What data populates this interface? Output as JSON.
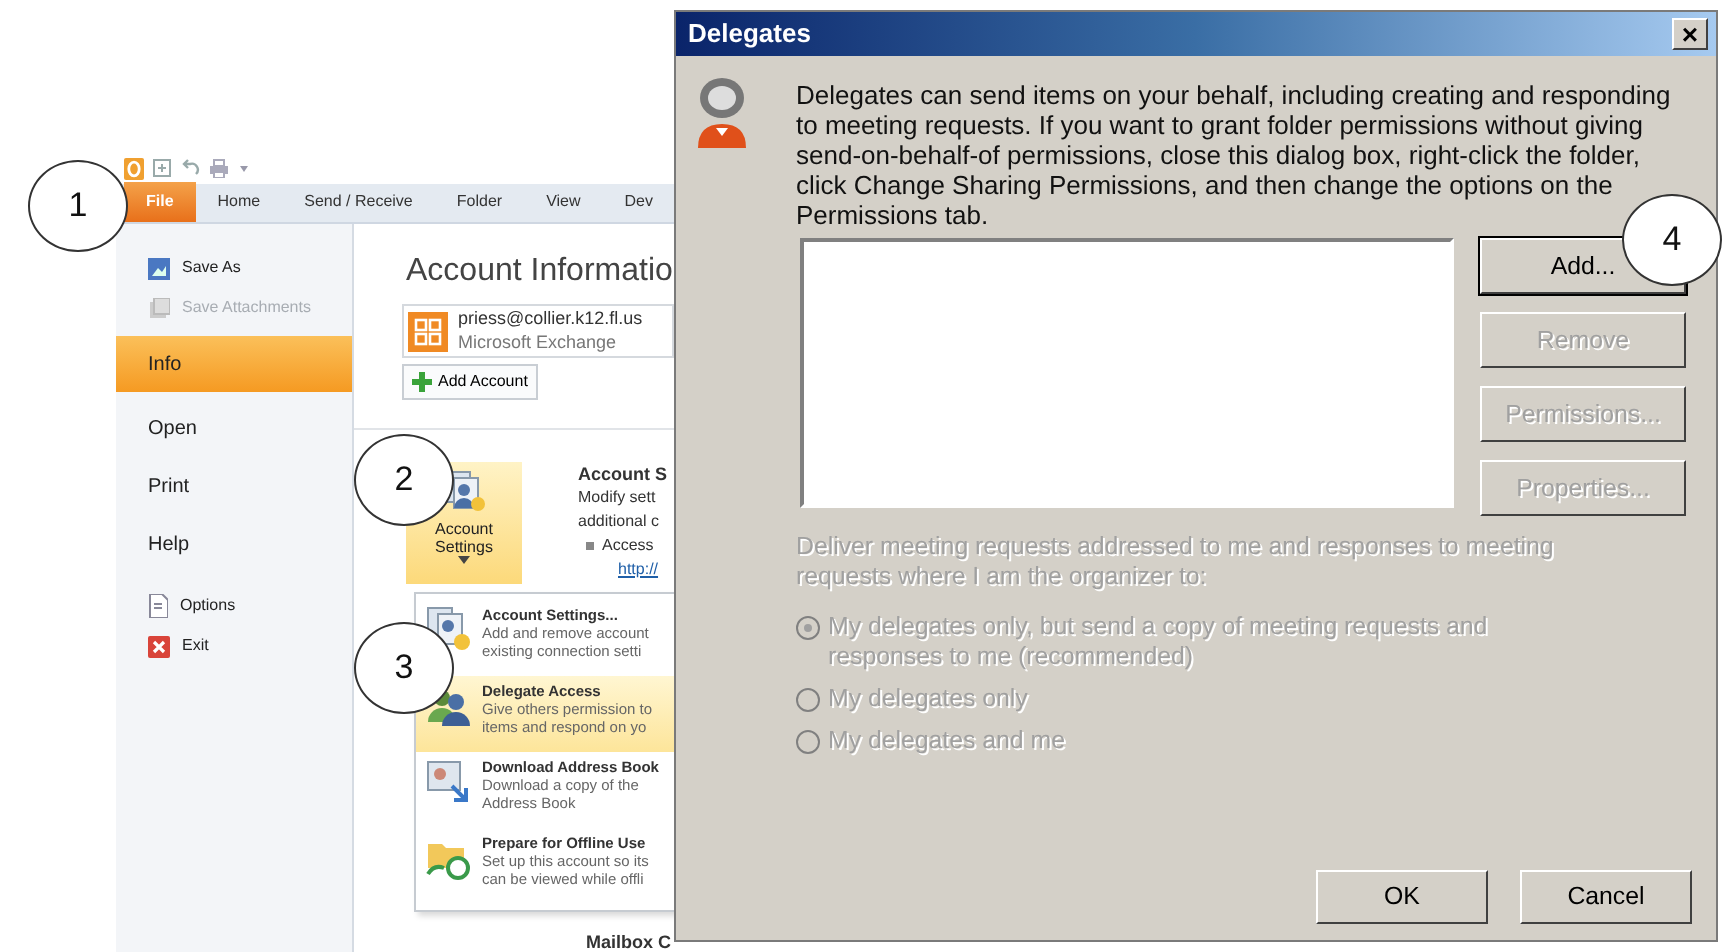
{
  "outlook": {
    "tabs": [
      {
        "label": "File",
        "selected": true
      },
      {
        "label": "Home",
        "selected": false
      },
      {
        "label": "Send / Receive",
        "selected": false
      },
      {
        "label": "Folder",
        "selected": false
      },
      {
        "label": "View",
        "selected": false
      },
      {
        "label": "Dev",
        "selected": false
      }
    ],
    "nav": [
      {
        "label": "Save As",
        "kind": "command",
        "selected": false,
        "disabled": false
      },
      {
        "label": "Save Attachments",
        "kind": "command",
        "selected": false,
        "disabled": true
      },
      {
        "label": "Info",
        "kind": "page",
        "selected": true,
        "disabled": false
      },
      {
        "label": "Open",
        "kind": "page",
        "selected": false,
        "disabled": false
      },
      {
        "label": "Print",
        "kind": "page",
        "selected": false,
        "disabled": false
      },
      {
        "label": "Help",
        "kind": "page",
        "selected": false,
        "disabled": false
      },
      {
        "label": "Options",
        "kind": "command",
        "selected": false,
        "disabled": false
      },
      {
        "label": "Exit",
        "kind": "command",
        "selected": false,
        "disabled": false
      }
    ],
    "account": {
      "title": "Account Informatio",
      "email": "priess@collier.k12.fl.us",
      "type": "Microsoft Exchange",
      "add_button": "Add Account"
    },
    "settings": {
      "button": "Account Settings",
      "heading": "Account S",
      "lines": [
        "Modify sett",
        "additional c"
      ],
      "bullet": "Access",
      "link": "http://"
    },
    "menu": [
      {
        "title": "Account Settings...",
        "lines": [
          "Add and remove account",
          "existing connection setti"
        ],
        "selected": false
      },
      {
        "title": "Delegate Access",
        "lines": [
          "Give others permission to",
          "items and respond on yo"
        ],
        "selected": true
      },
      {
        "title": "Download Address Book",
        "lines": [
          "Download a copy of the",
          "Address Book"
        ],
        "selected": false
      },
      {
        "title": "Prepare for Offline Use",
        "lines": [
          "Set up this account so its",
          "can be viewed while offli"
        ],
        "selected": false
      }
    ],
    "mailbox_heading": "Mailbox C"
  },
  "dialog": {
    "title": "Delegates",
    "close": "×",
    "text": "Delegates can send items on your behalf, including creating and responding to meeting requests. If you want to grant folder permissions without giving send-on-behalf-of permissions, close this dialog box, right-click the folder, click Change Sharing Permissions, and then change the options on the Permissions tab.",
    "side_buttons": [
      {
        "label": "Add...",
        "disabled": false,
        "default": true
      },
      {
        "label": "Remove",
        "disabled": true,
        "default": false
      },
      {
        "label": "Permissions...",
        "disabled": true,
        "default": false
      },
      {
        "label": "Properties...",
        "disabled": true,
        "default": false
      }
    ],
    "deliver_label": "Deliver meeting requests addressed to me and responses to meeting requests where I am the organizer to:",
    "deliver_disabled": true,
    "radios": [
      {
        "label": "My delegates only, but send a copy of meeting requests and responses to me (recommended)",
        "selected": true,
        "disabled": true
      },
      {
        "label": "My delegates only",
        "selected": false,
        "disabled": true
      },
      {
        "label": "My delegates and me",
        "selected": false,
        "disabled": true
      }
    ],
    "footer_buttons": [
      "OK",
      "Cancel"
    ]
  },
  "callouts": [
    "1",
    "2",
    "3",
    "4"
  ]
}
